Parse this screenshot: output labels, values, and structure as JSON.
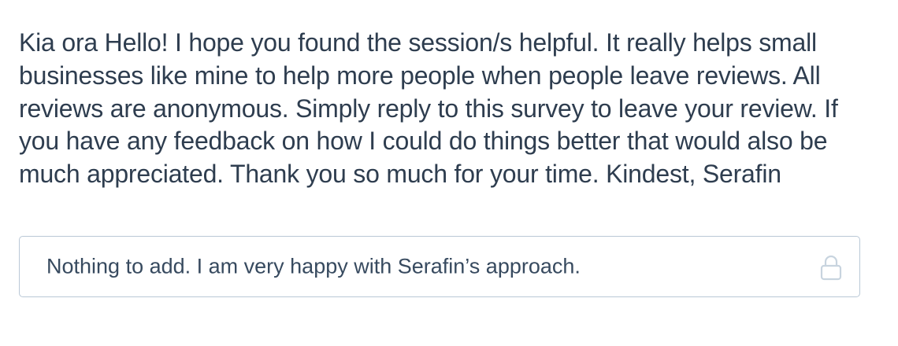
{
  "survey": {
    "question_text": "Kia ora Hello! I hope you found the session/s helpful. It really helps small businesses like mine to help more people when people leave reviews. All reviews are anonymous. Simply reply to this survey to leave your review. If you have any feedback on how I could do things better that would also be much appreciated. Thank you so much for your time. Kindest, Serafin",
    "answer_text": "Nothing to add. I am very happy with Serafin’s approach.",
    "answer_icon": "lock-icon"
  },
  "colors": {
    "text": "#2e3d4f",
    "answer_border": "#b9c8d6",
    "lock_icon": "#c8d4df"
  }
}
